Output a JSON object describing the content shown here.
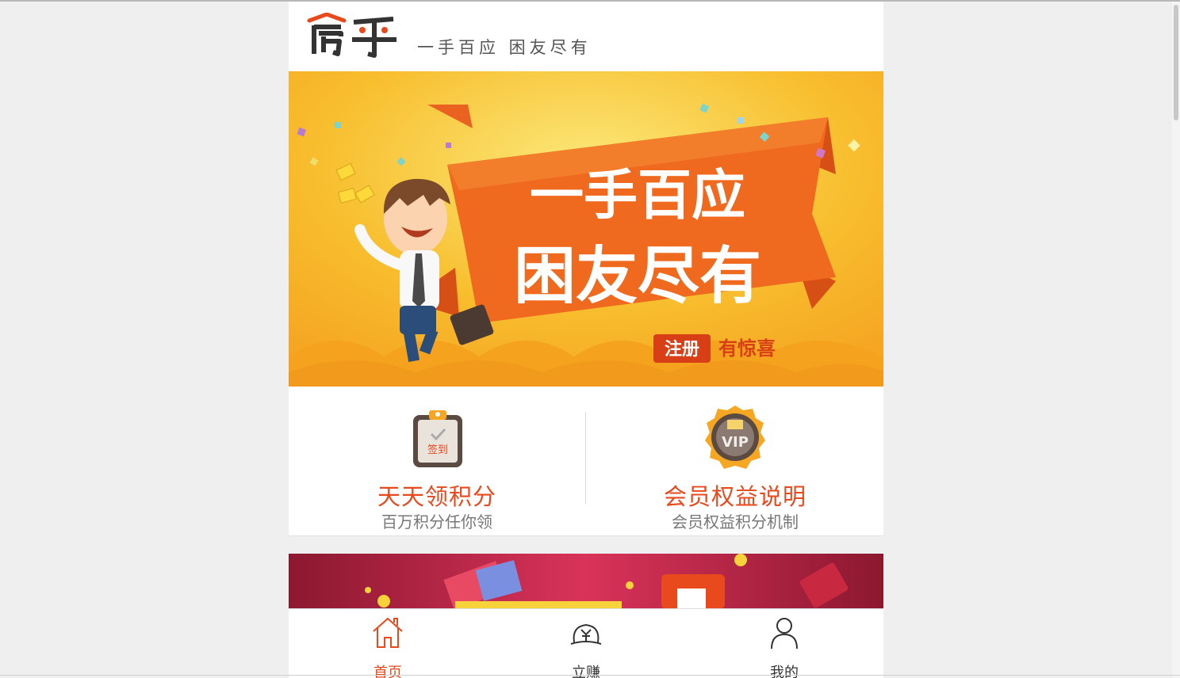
{
  "header": {
    "logo_text": "房乎",
    "slogan": "一手百应 困友尽有"
  },
  "banner": {
    "line1": "一手百应",
    "line2": "困友尽有",
    "badge": "注册",
    "badge_suffix": "有惊喜"
  },
  "features": [
    {
      "icon": "clipboard-sign-in-icon",
      "icon_text": "签到",
      "title": "天天领积分",
      "subtitle": "百万积分任你领"
    },
    {
      "icon": "vip-badge-icon",
      "icon_text": "VIP",
      "title": "会员权益说明",
      "subtitle": "会员权益积分机制"
    }
  ],
  "tabbar": {
    "active_color": "#e8491d",
    "items": [
      {
        "icon": "home-icon",
        "label": "首页",
        "active": true
      },
      {
        "icon": "coin-earn-icon",
        "label": "立赚",
        "active": false
      },
      {
        "icon": "user-icon",
        "label": "我的",
        "active": false
      }
    ]
  },
  "colors": {
    "accent": "#e8491d",
    "banner_bg": "#f7b52b",
    "promo_bg": "#c42445"
  }
}
